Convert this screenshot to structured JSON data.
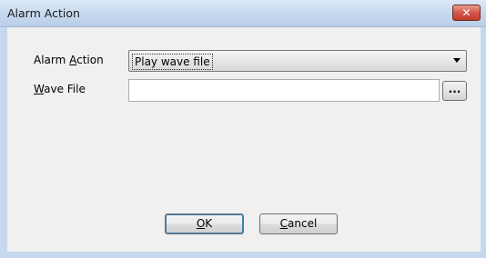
{
  "window": {
    "title": "Alarm Action"
  },
  "form": {
    "alarm_action_label": {
      "prefix": "Alarm ",
      "accel": "A",
      "rest": "ction"
    },
    "alarm_action_value": "Play wave file",
    "wave_file_label": {
      "accel": "W",
      "rest": "ave File"
    },
    "wave_file_value": "",
    "browse_label": "..."
  },
  "buttons": {
    "ok": {
      "accel": "O",
      "rest": "K"
    },
    "cancel": {
      "accel": "C",
      "rest": "ancel"
    }
  },
  "colors": {
    "titlebar": "#c6d8ee",
    "close": "#c33c2c",
    "client": "#f0f0f0"
  }
}
